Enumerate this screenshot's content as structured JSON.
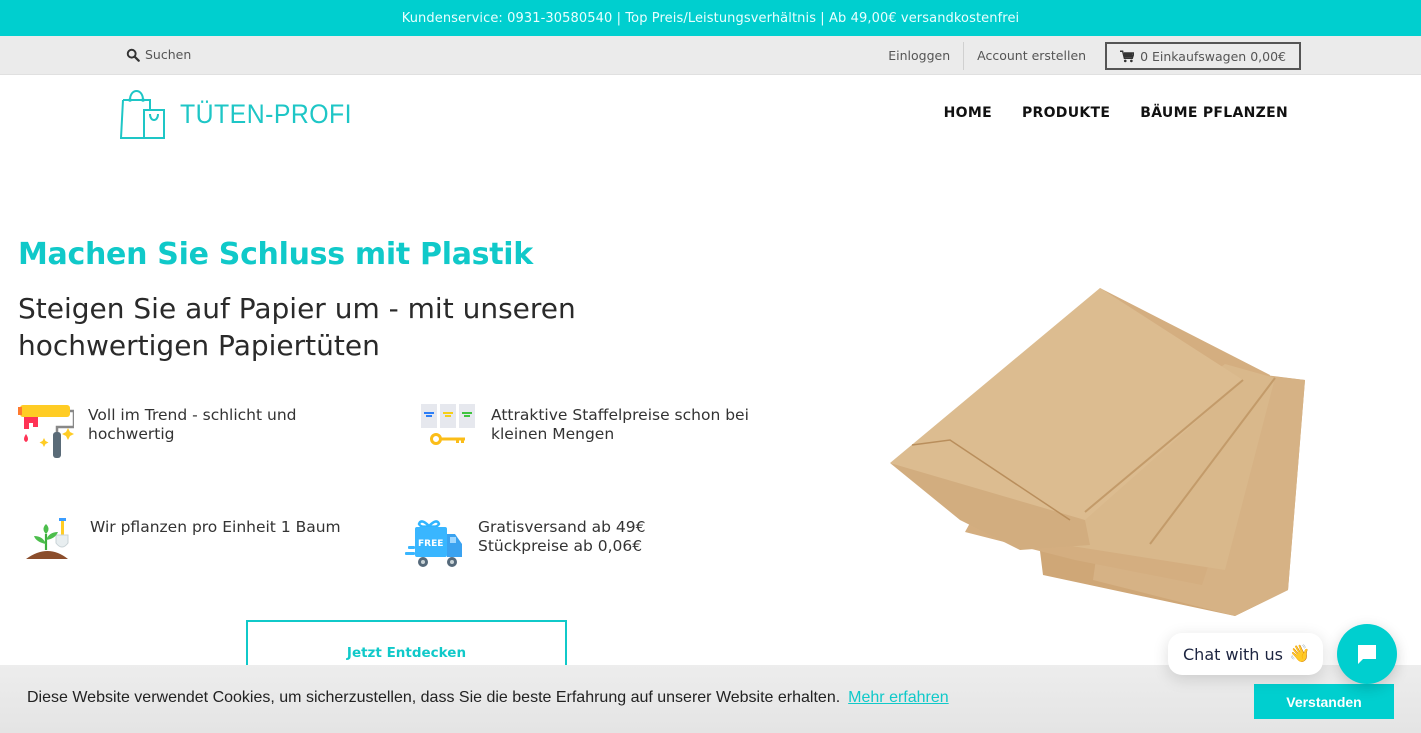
{
  "announcement": "Kundenservice: 0931-30580540 | Top Preis/Leistungsverhältnis | Ab 49,00€ versandkostenfrei",
  "utility": {
    "search_label": "Suchen",
    "login": "Einloggen",
    "register": "Account erstellen",
    "cart_label": "0 Einkaufswagen 0,00€"
  },
  "header": {
    "logo_text": "TÜTEN-PROFI",
    "nav": [
      "HOME",
      "PRODUKTE",
      "BÄUME PFLANZEN"
    ]
  },
  "hero": {
    "title": "Machen Sie Schluss mit Plastik",
    "subtitle": "Steigen Sie auf Papier um - mit unseren hochwertigen Papiertüten",
    "features": [
      {
        "icon": "paint-roller-icon",
        "text": "Voll im Trend - schlicht und hochwertig"
      },
      {
        "icon": "price-tier-key-icon",
        "text": "Attraktive Staffelpreise schon bei kleinen Mengen"
      },
      {
        "icon": "plant-shovel-icon",
        "text": "Wir pflanzen pro Einheit 1 Baum"
      },
      {
        "icon": "free-delivery-truck-icon",
        "text_line1": "Gratisversand ab 49€",
        "text_line2": "Stückpreise ab 0,06€"
      }
    ],
    "cta": "Jetzt Entdecken"
  },
  "cookie": {
    "text": "Diese Website verwendet Cookies, um sicherzustellen, dass Sie die beste Erfahrung auf unserer Website erhalten.",
    "link": "Mehr erfahren",
    "button": "Verstanden"
  },
  "chat": {
    "label": "Chat with us",
    "emoji": "👋"
  },
  "colors": {
    "accent": "#00cfcf",
    "utility_bg": "#ebebeb",
    "text_dark": "#2a2a2a"
  }
}
